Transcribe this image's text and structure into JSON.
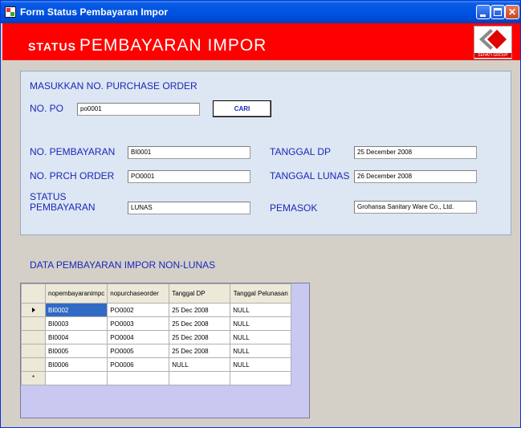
{
  "window": {
    "title": "Form Status Pembayaran Impor"
  },
  "banner": {
    "title_small": "STATUS",
    "title_big": "PEMBAYARAN IMPOR",
    "logo_caption": "SEHATI GROUP"
  },
  "search": {
    "heading": "MASUKKAN NO. PURCHASE ORDER",
    "po_label": "NO. PO",
    "po_value": "po0001",
    "button_label": "CARI"
  },
  "detail": {
    "no_pembayaran_label": "NO. PEMBAYARAN",
    "no_pembayaran_value": "BI0001",
    "no_prch_order_label": "NO. PRCH ORDER",
    "no_prch_order_value": "PO0001",
    "status_label_1": "STATUS",
    "status_label_2": "PEMBAYARAN",
    "status_value": "LUNAS",
    "tanggal_dp_label": "TANGGAL DP",
    "tanggal_dp_value": "25 December 2008",
    "tanggal_lunas_label": "TANGGAL LUNAS",
    "tanggal_lunas_value": "26 December 2008",
    "pemasok_label": "PEMASOK",
    "pemasok_value": "Grohansa Sanitary Ware Co., Ltd."
  },
  "grid": {
    "title": "DATA PEMBAYARAN IMPOR NON-LUNAS",
    "columns": [
      "nopembayaranimpc",
      "nopurchaseorder",
      "Tanggal DP",
      "Tanggal Pelunasan"
    ],
    "rows": [
      [
        "BI0002",
        "PO0002",
        "25 Dec 2008",
        "NULL"
      ],
      [
        "BI0003",
        "PO0003",
        "25 Dec 2008",
        "NULL"
      ],
      [
        "BI0004",
        "PO0004",
        "25 Dec 2008",
        "NULL"
      ],
      [
        "BI0005",
        "PO0005",
        "25 Dec 2008",
        "NULL"
      ],
      [
        "BI0006",
        "PO0006",
        "NULL",
        "NULL"
      ]
    ],
    "new_row_marker": "*"
  },
  "colors": {
    "banner": "#FF0000",
    "label_blue": "#1A28B8",
    "panel": "#DDE6F3",
    "selection": "#316AC5"
  }
}
